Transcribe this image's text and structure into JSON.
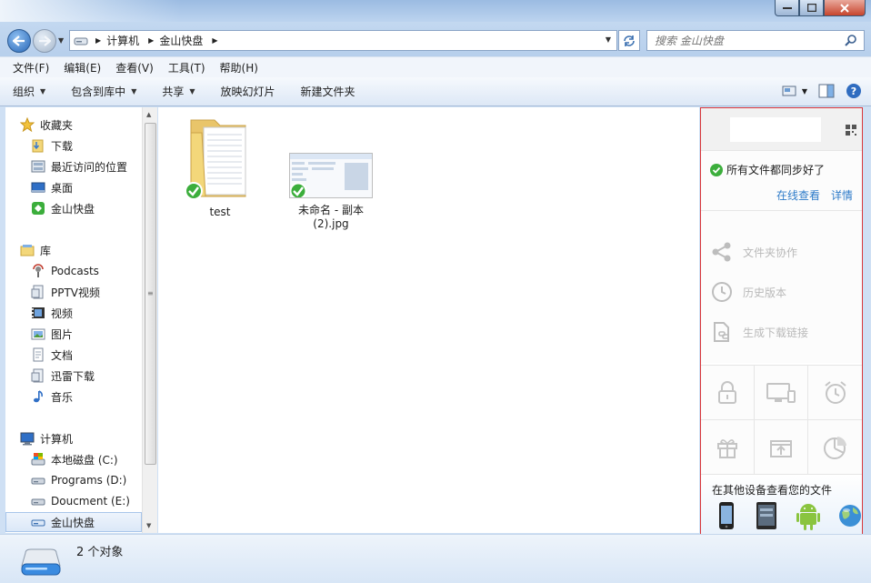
{
  "window": {
    "min": "0",
    "max": "1",
    "close": "r"
  },
  "address": {
    "crumbs": [
      "计算机",
      "金山快盘"
    ]
  },
  "search": {
    "placeholder": "搜索 金山快盘"
  },
  "menu": [
    "文件(F)",
    "编辑(E)",
    "查看(V)",
    "工具(T)",
    "帮助(H)"
  ],
  "toolbar": {
    "organize": "组织",
    "include": "包含到库中",
    "share": "共享",
    "slideshow": "放映幻灯片",
    "newfolder": "新建文件夹"
  },
  "nav": {
    "favorites": "收藏夹",
    "fav_items": [
      "下载",
      "最近访问的位置",
      "桌面",
      "金山快盘"
    ],
    "library": "库",
    "lib_items": [
      "Podcasts",
      "PPTV视频",
      "视频",
      "图片",
      "文档",
      "迅雷下载",
      "音乐"
    ],
    "computer": "计算机",
    "comp_items": [
      "本地磁盘 (C:)",
      "Programs (D:)",
      "Doucment (E:)",
      "金山快盘"
    ]
  },
  "files": [
    {
      "name": "test"
    },
    {
      "name_line1": "未命名 - 副本",
      "name_line2": "(2).jpg"
    }
  ],
  "kuaipan": {
    "sync_status": "所有文件都同步好了",
    "view_online": "在线查看",
    "details": "详情",
    "actions": [
      "文件夹协作",
      "历史版本",
      "生成下载链接"
    ],
    "devices_title": "在其他设备查看您的文件",
    "colors": {
      "accent": "#2e7bc9",
      "green": "#3cae3c",
      "border": "#d9363a"
    }
  },
  "status": {
    "count": "2 个对象"
  }
}
